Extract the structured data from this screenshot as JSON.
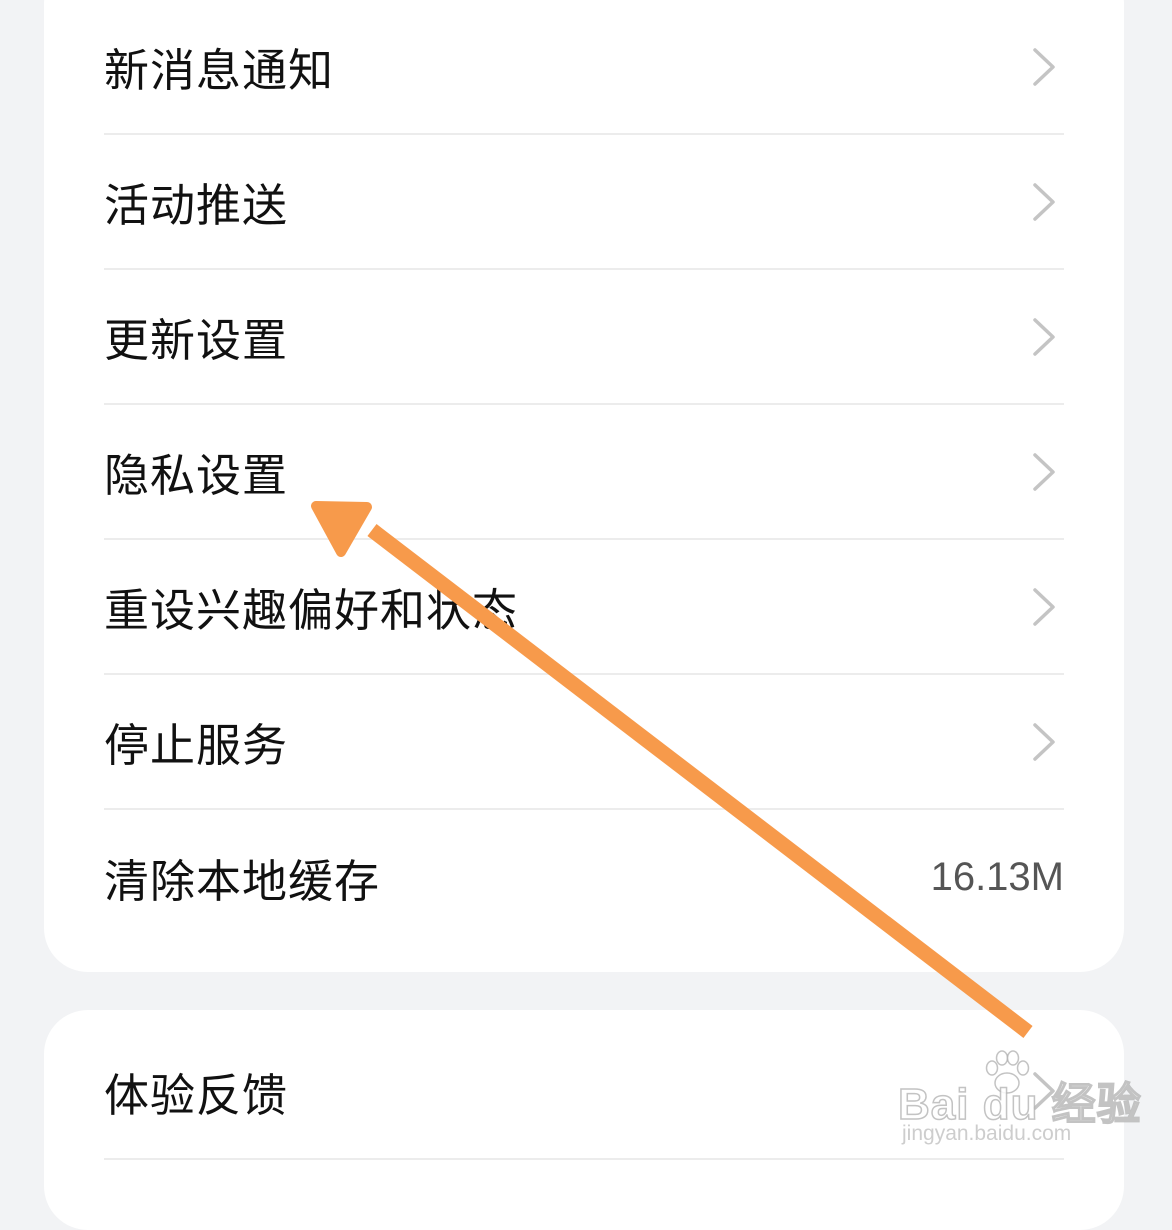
{
  "settings_card": {
    "items": [
      {
        "label": "新消息通知"
      },
      {
        "label": "活动推送"
      },
      {
        "label": "更新设置"
      },
      {
        "label": "隐私设置"
      },
      {
        "label": "重设兴趣偏好和状态"
      },
      {
        "label": "停止服务"
      },
      {
        "label": "清除本地缓存",
        "value": "16.13M"
      }
    ]
  },
  "secondary_card": {
    "items": [
      {
        "label": "体验反馈"
      }
    ]
  },
  "annotation": {
    "color": "#f79a4b",
    "target": "隐私设置"
  },
  "watermark": {
    "brand": "Bai du 经验",
    "url": "jingyan.baidu.com"
  }
}
